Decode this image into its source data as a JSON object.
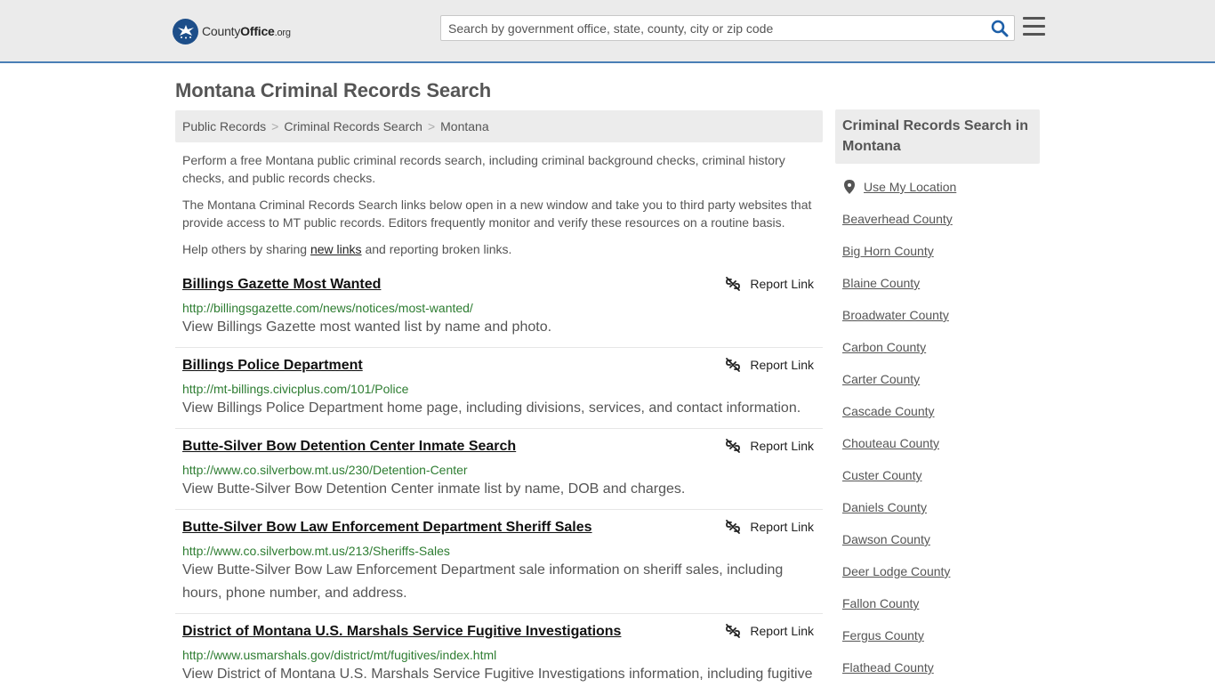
{
  "header": {
    "logo_county": "County",
    "logo_office": "Office",
    "logo_tld": ".org",
    "search_placeholder": "Search by government office, state, county, city or zip code",
    "accent_color": "#4a7fb6"
  },
  "page": {
    "title": "Montana Criminal Records Search"
  },
  "breadcrumb": [
    {
      "label": "Public Records"
    },
    {
      "label": "Criminal Records Search"
    },
    {
      "label": "Montana"
    }
  ],
  "intro": {
    "p1": "Perform a free Montana public criminal records search, including criminal background checks, criminal history checks, and public records checks.",
    "p2": "The Montana Criminal Records Search links below open in a new window and take you to third party websites that provide access to MT public records. Editors frequently monitor and verify these resources on a routine basis.",
    "p3_before": "Help others by sharing ",
    "p3_link": "new links",
    "p3_after": " and reporting broken links."
  },
  "report_label": "Report Link",
  "results": [
    {
      "title": "Billings Gazette Most Wanted",
      "url": "http://billingsgazette.com/news/notices/most-wanted/",
      "desc": "View Billings Gazette most wanted list by name and photo."
    },
    {
      "title": "Billings Police Department",
      "url": "http://mt-billings.civicplus.com/101/Police",
      "desc": "View Billings Police Department home page, including divisions, services, and contact information."
    },
    {
      "title": "Butte-Silver Bow Detention Center Inmate Search",
      "url": "http://www.co.silverbow.mt.us/230/Detention-Center",
      "desc": "View Butte-Silver Bow Detention Center inmate list by name, DOB and charges."
    },
    {
      "title": "Butte-Silver Bow Law Enforcement Department Sheriff Sales",
      "url": "http://www.co.silverbow.mt.us/213/Sheriffs-Sales",
      "desc": "View Butte-Silver Bow Law Enforcement Department sale information on sheriff sales, including hours, phone number, and address."
    },
    {
      "title": "District of Montana U.S. Marshals Service Fugitive Investigations",
      "url": "http://www.usmarshals.gov/district/mt/fugitives/index.html",
      "desc": "View District of Montana U.S. Marshals Service Fugitive Investigations information, including fugitive"
    }
  ],
  "sidebar": {
    "heading": "Criminal Records Search in Montana",
    "use_location": "Use My Location",
    "counties": [
      "Beaverhead County",
      "Big Horn County",
      "Blaine County",
      "Broadwater County",
      "Carbon County",
      "Carter County",
      "Cascade County",
      "Chouteau County",
      "Custer County",
      "Daniels County",
      "Dawson County",
      "Deer Lodge County",
      "Fallon County",
      "Fergus County",
      "Flathead County"
    ]
  }
}
